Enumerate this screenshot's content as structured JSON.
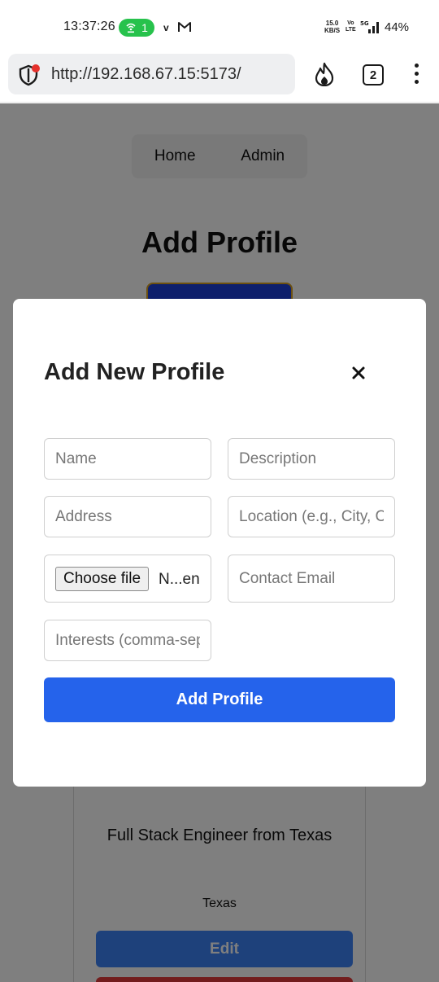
{
  "status_bar": {
    "time": "13:37:26",
    "hotspot_count": "1",
    "carrier_letter": "v",
    "net_speed_value": "15.0",
    "net_speed_unit": "KB/S",
    "volte_top": "Vo",
    "volte_bottom": "LTE",
    "battery": "44%",
    "icons": [
      "hotspot-icon",
      "gmail-icon",
      "signal-icon"
    ]
  },
  "browser": {
    "url": "http://192.168.67.15:5173/",
    "tab_count": "2",
    "icons": [
      "shield-icon",
      "flame-icon",
      "more-vert-icon"
    ]
  },
  "page": {
    "nav": {
      "home": "Home",
      "admin": "Admin"
    },
    "title": "Add Profile",
    "card": {
      "description": "Full Stack Engineer from Texas",
      "location": "Texas",
      "edit_label": "Edit"
    }
  },
  "modal": {
    "title": "Add New Profile",
    "close_icon": "close-icon",
    "fields": {
      "name_placeholder": "Name",
      "description_placeholder": "Description",
      "address_placeholder": "Address",
      "location_placeholder": "Location (e.g., City, Country)",
      "contact_email_placeholder": "Contact Email",
      "interests_placeholder": "Interests (comma-separated)"
    },
    "file": {
      "button_label": "Choose file",
      "status": "N...en"
    },
    "submit_label": "Add Profile"
  },
  "colors": {
    "primary_button": "#2563eb",
    "edit_button": "#3d82f6",
    "delete_button": "#e53a3a",
    "hotspot_pill": "#27c24c"
  }
}
